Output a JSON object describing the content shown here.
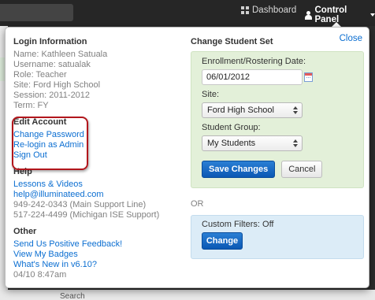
{
  "nav": {
    "dashboard_label": "Dashboard",
    "control_panel_label": "Control Panel"
  },
  "background": {
    "bottom_text": "Search"
  },
  "panel": {
    "close_label": "Close",
    "login": {
      "heading": "Login Information",
      "name": "Name: Kathleen Satuala",
      "username": "Username: satualak",
      "role": "Role: Teacher",
      "site": "Site: Ford High School",
      "session": "Session: 2011-2012",
      "term": "Term: FY"
    },
    "edit_account": {
      "heading": "Edit Account",
      "change_password": "Change Password",
      "relogin_admin": "Re-login as Admin",
      "sign_out": "Sign Out"
    },
    "help": {
      "heading": "Help",
      "lessons_videos": "Lessons & Videos",
      "email": "help@illuminateed.com",
      "main_support": "949-242-0343 (Main Support Line)",
      "michigan_support": "517-224-4499 (Michigan ISE Support)"
    },
    "other": {
      "heading": "Other",
      "feedback": "Send Us Positive Feedback!",
      "badges": "View My Badges",
      "whats_new": "What's New in v6.10?",
      "timestamp": "04/10 8:47am"
    },
    "student_set": {
      "heading": "Change Student Set",
      "enrollment_label": "Enrollment/Rostering Date:",
      "enrollment_value": "06/01/2012",
      "site_label": "Site:",
      "site_value": "Ford High School",
      "group_label": "Student Group:",
      "group_value": "My Students",
      "save_label": "Save Changes",
      "cancel_label": "Cancel"
    },
    "or_label": "OR",
    "filters": {
      "label": "Custom Filters: Off",
      "change_label": "Change"
    }
  },
  "colors": {
    "link": "#0b6ed1",
    "highlight_border": "#b2161c",
    "green_panel": "#e3f0d9",
    "blue_panel": "#dcecf7",
    "primary_button": "#0b58b4"
  }
}
